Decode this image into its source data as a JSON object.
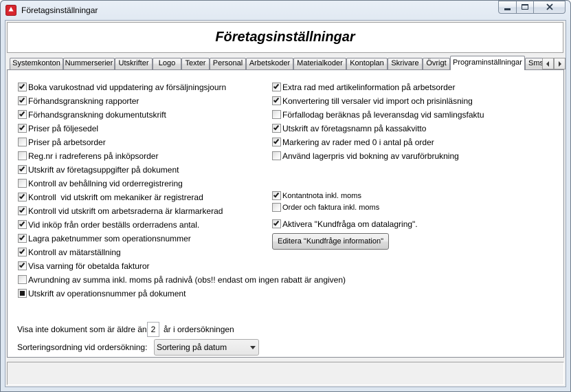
{
  "window": {
    "title": "Företagsinställningar",
    "icons": {
      "app": "app-icon",
      "minimize": "minimize-icon",
      "maximize": "maximize-icon",
      "close": "close-icon"
    }
  },
  "colors": {
    "frame": "#dde6f0",
    "client": "#f0f0f0",
    "panel": "#ffffff",
    "app_icon": "#d7262e",
    "tab_border": "#898c95"
  },
  "header": {
    "title": "Företagsinställningar"
  },
  "tabs": [
    {
      "label": "Systemkonton",
      "selected": false
    },
    {
      "label": "Nummerserier",
      "selected": false
    },
    {
      "label": "Utskrifter",
      "selected": false
    },
    {
      "label": "Logo",
      "selected": false
    },
    {
      "label": "Texter",
      "selected": false
    },
    {
      "label": "Personal",
      "selected": false
    },
    {
      "label": "Arbetskoder",
      "selected": false
    },
    {
      "label": "Materialkoder",
      "selected": false
    },
    {
      "label": "Kontoplan",
      "selected": false
    },
    {
      "label": "Skrivare",
      "selected": false
    },
    {
      "label": "Övrigt",
      "selected": false
    },
    {
      "label": "Programinställningar",
      "selected": true
    },
    {
      "label": "Sms",
      "selected": false
    }
  ],
  "tab_scroll_icons": {
    "left": "left-arrow-icon",
    "right": "right-arrow-icon"
  },
  "left_options": [
    {
      "label": "Boka varukostnad vid uppdatering av försäljningsjourn",
      "checked": true
    },
    {
      "label": "Förhandsgranskning rapporter",
      "checked": true
    },
    {
      "label": "Förhandsgranskning dokumentutskrift",
      "checked": true
    },
    {
      "label": "Priser på följesedel",
      "checked": true
    },
    {
      "label": "Priser på arbetsorder",
      "checked": false
    },
    {
      "label": "Reg.nr i radreferens på inköpsorder",
      "checked": false
    },
    {
      "label": "Utskrift av företagsuppgifter på dokument",
      "checked": true
    },
    {
      "label": "Kontroll av behållning vid orderregistrering",
      "checked": false
    },
    {
      "label": "Kontroll  vid utskrift om mekaniker är registrerad",
      "checked": true
    },
    {
      "label": "Kontroll vid utskrift om arbetsraderna är klarmarkerad",
      "checked": true
    },
    {
      "label": "Vid inköp från order beställs orderradens antal.",
      "checked": true
    },
    {
      "label": "Lagra paketnummer som operationsnummer",
      "checked": true
    },
    {
      "label": "Kontroll av mätarställning",
      "checked": true
    },
    {
      "label": "Visa varning för obetalda fakturor",
      "checked": true
    },
    {
      "label": "Avrundning av summa inkl. moms på radnivå (obs!! endast om ingen rabatt är angiven)",
      "checked": false
    },
    {
      "label": "Utskrift av operationsnummer på dokument",
      "checked": false,
      "indeterminate": true
    }
  ],
  "right_options": [
    {
      "label": "Extra rad med artikelinformation på arbetsorder",
      "checked": true
    },
    {
      "label": "Konvertering till versaler vid import och prisinläsning",
      "checked": true
    },
    {
      "label": "Förfallodag beräknas på leveransdag vid samlingsfaktu",
      "checked": false
    },
    {
      "label": "Utskrift av företagsnamn på kassakvitto",
      "checked": true
    },
    {
      "label": "Markering av rader med 0 i antal på order",
      "checked": true
    },
    {
      "label": "Använd lagerpris vid bokning av varuförbrukning",
      "checked": false
    }
  ],
  "vat_options": [
    {
      "label": "Kontantnota inkl. moms",
      "checked": true
    },
    {
      "label": "Order och faktura inkl. moms",
      "checked": false
    }
  ],
  "customer_query": {
    "option": {
      "label": "Aktivera \"Kundfråga om datalagring\".",
      "checked": true
    },
    "edit_button": "Editera \"Kundfråge information\""
  },
  "doc_age": {
    "prefix": "Visa inte dokument som är äldre än",
    "value": "2",
    "suffix": "år i ordersökningen"
  },
  "sort_order": {
    "label": "Sorteringsordning vid ordersökning:",
    "selected": "Sortering på datum",
    "icon": "chevron-down-icon"
  }
}
